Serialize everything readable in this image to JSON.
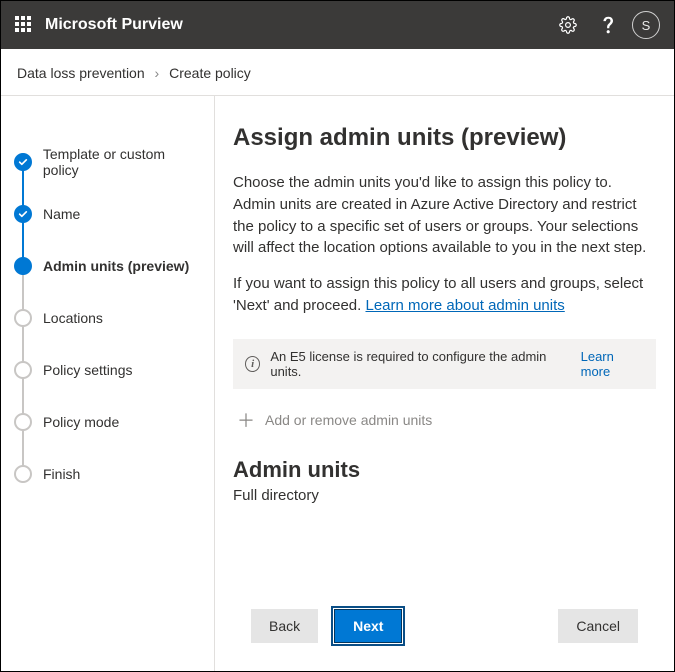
{
  "header": {
    "brand": "Microsoft Purview",
    "avatar_letter": "S"
  },
  "breadcrumb": {
    "parent": "Data loss prevention",
    "current": "Create policy"
  },
  "steps": [
    {
      "label": "Template or custom policy",
      "state": "done"
    },
    {
      "label": "Name",
      "state": "done"
    },
    {
      "label": "Admin units (preview)",
      "state": "current"
    },
    {
      "label": "Locations",
      "state": "pending"
    },
    {
      "label": "Policy settings",
      "state": "pending"
    },
    {
      "label": "Policy mode",
      "state": "pending"
    },
    {
      "label": "Finish",
      "state": "pending"
    }
  ],
  "main": {
    "title": "Assign admin units (preview)",
    "description1": "Choose the admin units you'd like to assign this policy to. Admin units are created in Azure Active Directory and restrict the policy to a specific set of users or groups. Your selections will affect the location options available to you in the next step.",
    "description2a": "If you want to assign this policy to all users and groups, select 'Next' and proceed. ",
    "learn_link": "Learn more about admin units",
    "banner_text": "An E5 license is required to configure the admin units.",
    "banner_learn": "Learn more",
    "add_label": "Add or remove admin units",
    "section_heading": "Admin units",
    "section_value": "Full directory"
  },
  "buttons": {
    "back": "Back",
    "next": "Next",
    "cancel": "Cancel"
  }
}
